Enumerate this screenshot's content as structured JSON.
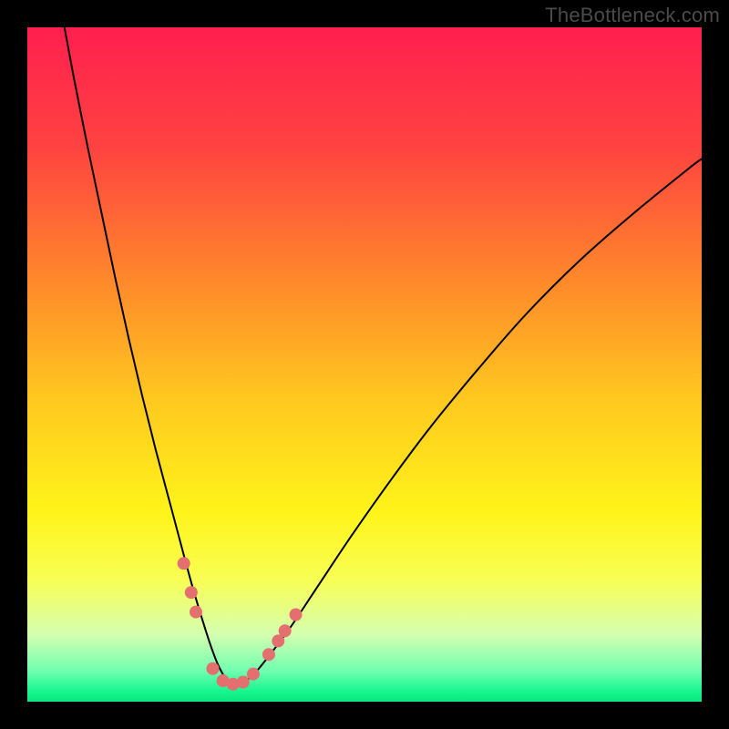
{
  "watermark": "TheBottleneck.com",
  "chart_data": {
    "type": "line",
    "title": "",
    "xlabel": "",
    "ylabel": "",
    "xlim": [
      0,
      100
    ],
    "ylim": [
      0,
      100
    ],
    "background_gradient": {
      "stops": [
        {
          "offset": 0.0,
          "color": "#ff1f4f"
        },
        {
          "offset": 0.18,
          "color": "#ff4340"
        },
        {
          "offset": 0.38,
          "color": "#ff8a2a"
        },
        {
          "offset": 0.55,
          "color": "#ffc81f"
        },
        {
          "offset": 0.72,
          "color": "#fff41a"
        },
        {
          "offset": 0.82,
          "color": "#f8ff55"
        },
        {
          "offset": 0.9,
          "color": "#d5ffb0"
        },
        {
          "offset": 0.955,
          "color": "#6fffb0"
        },
        {
          "offset": 0.985,
          "color": "#17f58e"
        },
        {
          "offset": 1.0,
          "color": "#09e77e"
        }
      ]
    },
    "series": [
      {
        "name": "bottleneck-curve",
        "color": "#000000",
        "stroke_width": 2,
        "x": [
          5.5,
          7,
          9,
          11,
          13,
          15,
          17,
          19,
          21,
          23,
          24.5,
          26,
          27.3,
          28.5,
          30,
          31.5,
          33.5,
          36,
          39,
          43,
          48,
          54,
          60,
          67,
          74,
          82,
          90,
          98,
          100
        ],
        "y": [
          100,
          92,
          82,
          72.5,
          63,
          54,
          45.5,
          37.5,
          30,
          22.5,
          17,
          12,
          8,
          5,
          2.7,
          2.7,
          4,
          7,
          11,
          17,
          24.5,
          33,
          41,
          49.5,
          57.5,
          65.5,
          72.5,
          79,
          80.5
        ]
      }
    ],
    "markers": {
      "name": "highlight-points",
      "color": "#e36f6f",
      "radius": 7,
      "points": [
        {
          "x": 23.2,
          "y": 20.5
        },
        {
          "x": 24.3,
          "y": 16.2
        },
        {
          "x": 25.0,
          "y": 13.3
        },
        {
          "x": 27.5,
          "y": 4.9
        },
        {
          "x": 29.0,
          "y": 3.1
        },
        {
          "x": 30.5,
          "y": 2.6
        },
        {
          "x": 32.0,
          "y": 2.9
        },
        {
          "x": 33.5,
          "y": 4.1
        },
        {
          "x": 35.8,
          "y": 7.0
        },
        {
          "x": 37.2,
          "y": 9.0
        },
        {
          "x": 38.2,
          "y": 10.5
        },
        {
          "x": 39.8,
          "y": 12.9
        }
      ]
    }
  }
}
